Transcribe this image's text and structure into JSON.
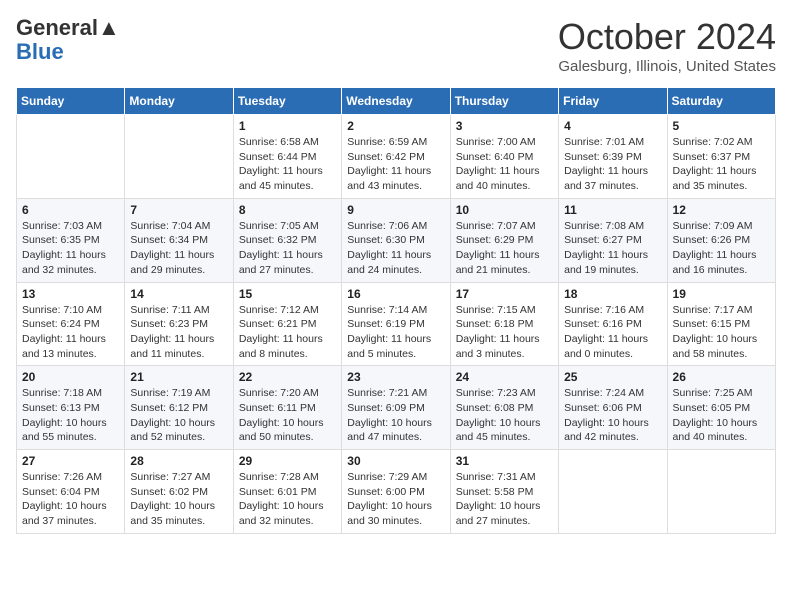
{
  "header": {
    "logo_general": "General",
    "logo_blue": "Blue",
    "month_title": "October 2024",
    "subtitle": "Galesburg, Illinois, United States"
  },
  "days_of_week": [
    "Sunday",
    "Monday",
    "Tuesday",
    "Wednesday",
    "Thursday",
    "Friday",
    "Saturday"
  ],
  "weeks": [
    [
      {
        "day": "",
        "info": ""
      },
      {
        "day": "",
        "info": ""
      },
      {
        "day": "1",
        "info": "Sunrise: 6:58 AM\nSunset: 6:44 PM\nDaylight: 11 hours and 45 minutes."
      },
      {
        "day": "2",
        "info": "Sunrise: 6:59 AM\nSunset: 6:42 PM\nDaylight: 11 hours and 43 minutes."
      },
      {
        "day": "3",
        "info": "Sunrise: 7:00 AM\nSunset: 6:40 PM\nDaylight: 11 hours and 40 minutes."
      },
      {
        "day": "4",
        "info": "Sunrise: 7:01 AM\nSunset: 6:39 PM\nDaylight: 11 hours and 37 minutes."
      },
      {
        "day": "5",
        "info": "Sunrise: 7:02 AM\nSunset: 6:37 PM\nDaylight: 11 hours and 35 minutes."
      }
    ],
    [
      {
        "day": "6",
        "info": "Sunrise: 7:03 AM\nSunset: 6:35 PM\nDaylight: 11 hours and 32 minutes."
      },
      {
        "day": "7",
        "info": "Sunrise: 7:04 AM\nSunset: 6:34 PM\nDaylight: 11 hours and 29 minutes."
      },
      {
        "day": "8",
        "info": "Sunrise: 7:05 AM\nSunset: 6:32 PM\nDaylight: 11 hours and 27 minutes."
      },
      {
        "day": "9",
        "info": "Sunrise: 7:06 AM\nSunset: 6:30 PM\nDaylight: 11 hours and 24 minutes."
      },
      {
        "day": "10",
        "info": "Sunrise: 7:07 AM\nSunset: 6:29 PM\nDaylight: 11 hours and 21 minutes."
      },
      {
        "day": "11",
        "info": "Sunrise: 7:08 AM\nSunset: 6:27 PM\nDaylight: 11 hours and 19 minutes."
      },
      {
        "day": "12",
        "info": "Sunrise: 7:09 AM\nSunset: 6:26 PM\nDaylight: 11 hours and 16 minutes."
      }
    ],
    [
      {
        "day": "13",
        "info": "Sunrise: 7:10 AM\nSunset: 6:24 PM\nDaylight: 11 hours and 13 minutes."
      },
      {
        "day": "14",
        "info": "Sunrise: 7:11 AM\nSunset: 6:23 PM\nDaylight: 11 hours and 11 minutes."
      },
      {
        "day": "15",
        "info": "Sunrise: 7:12 AM\nSunset: 6:21 PM\nDaylight: 11 hours and 8 minutes."
      },
      {
        "day": "16",
        "info": "Sunrise: 7:14 AM\nSunset: 6:19 PM\nDaylight: 11 hours and 5 minutes."
      },
      {
        "day": "17",
        "info": "Sunrise: 7:15 AM\nSunset: 6:18 PM\nDaylight: 11 hours and 3 minutes."
      },
      {
        "day": "18",
        "info": "Sunrise: 7:16 AM\nSunset: 6:16 PM\nDaylight: 11 hours and 0 minutes."
      },
      {
        "day": "19",
        "info": "Sunrise: 7:17 AM\nSunset: 6:15 PM\nDaylight: 10 hours and 58 minutes."
      }
    ],
    [
      {
        "day": "20",
        "info": "Sunrise: 7:18 AM\nSunset: 6:13 PM\nDaylight: 10 hours and 55 minutes."
      },
      {
        "day": "21",
        "info": "Sunrise: 7:19 AM\nSunset: 6:12 PM\nDaylight: 10 hours and 52 minutes."
      },
      {
        "day": "22",
        "info": "Sunrise: 7:20 AM\nSunset: 6:11 PM\nDaylight: 10 hours and 50 minutes."
      },
      {
        "day": "23",
        "info": "Sunrise: 7:21 AM\nSunset: 6:09 PM\nDaylight: 10 hours and 47 minutes."
      },
      {
        "day": "24",
        "info": "Sunrise: 7:23 AM\nSunset: 6:08 PM\nDaylight: 10 hours and 45 minutes."
      },
      {
        "day": "25",
        "info": "Sunrise: 7:24 AM\nSunset: 6:06 PM\nDaylight: 10 hours and 42 minutes."
      },
      {
        "day": "26",
        "info": "Sunrise: 7:25 AM\nSunset: 6:05 PM\nDaylight: 10 hours and 40 minutes."
      }
    ],
    [
      {
        "day": "27",
        "info": "Sunrise: 7:26 AM\nSunset: 6:04 PM\nDaylight: 10 hours and 37 minutes."
      },
      {
        "day": "28",
        "info": "Sunrise: 7:27 AM\nSunset: 6:02 PM\nDaylight: 10 hours and 35 minutes."
      },
      {
        "day": "29",
        "info": "Sunrise: 7:28 AM\nSunset: 6:01 PM\nDaylight: 10 hours and 32 minutes."
      },
      {
        "day": "30",
        "info": "Sunrise: 7:29 AM\nSunset: 6:00 PM\nDaylight: 10 hours and 30 minutes."
      },
      {
        "day": "31",
        "info": "Sunrise: 7:31 AM\nSunset: 5:58 PM\nDaylight: 10 hours and 27 minutes."
      },
      {
        "day": "",
        "info": ""
      },
      {
        "day": "",
        "info": ""
      }
    ]
  ]
}
